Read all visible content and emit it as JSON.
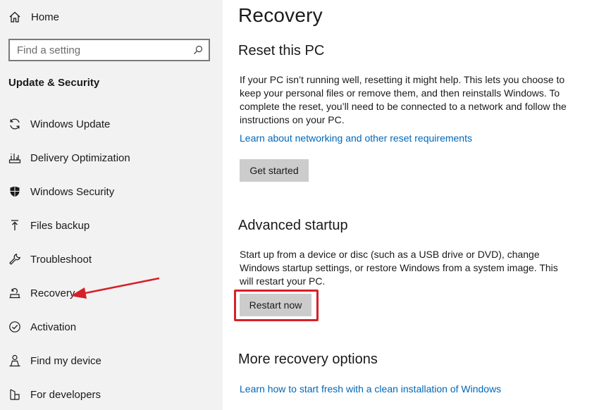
{
  "sidebar": {
    "home_label": "Home",
    "search_placeholder": "Find a setting",
    "section_title": "Update & Security",
    "items": [
      {
        "label": "Windows Update",
        "icon": "sync-icon"
      },
      {
        "label": "Delivery Optimization",
        "icon": "delivery-optimization-icon"
      },
      {
        "label": "Windows Security",
        "icon": "shield-icon"
      },
      {
        "label": "Files backup",
        "icon": "backup-arrow-icon"
      },
      {
        "label": "Troubleshoot",
        "icon": "wrench-icon"
      },
      {
        "label": "Recovery",
        "icon": "recovery-icon"
      },
      {
        "label": "Activation",
        "icon": "check-circle-icon"
      },
      {
        "label": "Find my device",
        "icon": "person-location-icon"
      },
      {
        "label": "For developers",
        "icon": "developer-icon"
      }
    ]
  },
  "main": {
    "title": "Recovery",
    "reset": {
      "heading": "Reset this PC",
      "description": "If your PC isn’t running well, resetting it might help. This lets you choose to keep your personal files or remove them, and then reinstalls Windows. To complete the reset, you’ll need to be connected to a network and follow the instructions on your PC.",
      "link": "Learn about networking and other reset requirements",
      "button": "Get started"
    },
    "advanced": {
      "heading": "Advanced startup",
      "description": "Start up from a device or disc (such as a USB drive or DVD), change Windows startup settings, or restore Windows from a system image. This will restart your PC.",
      "button": "Restart now"
    },
    "more": {
      "heading": "More recovery options",
      "link": "Learn how to start fresh with a clean installation of Windows"
    }
  },
  "colors": {
    "accent_link": "#0067b8",
    "annotation_red": "#d5202a",
    "sidebar_bg": "#f2f2f2",
    "button_bg": "#cccccc"
  }
}
